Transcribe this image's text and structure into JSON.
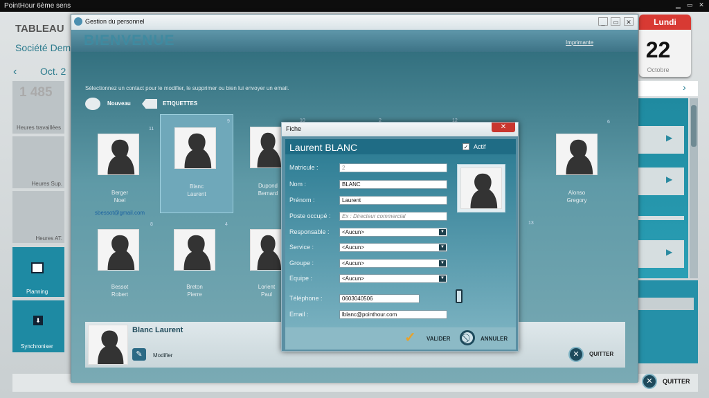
{
  "app": {
    "title": "PointHour 6ème sens",
    "dashboard_title": "TABLEAU",
    "company": "Société Dem",
    "month": "Oct. 2",
    "hours_value": "1 485",
    "tiles": [
      "Heures travaillées",
      "Heures Sup.",
      "Heures AT."
    ],
    "planning": "Planning",
    "sync": "Synchroniser",
    "quit": "QUITTER",
    "calendar": {
      "day_name": "Lundi",
      "day": "22",
      "month": "Octobre"
    }
  },
  "dialog": {
    "title": "Gestion du personnel",
    "banner": "BIENVENUE",
    "print": "Imprimante",
    "instruction": "Sélectionnez un contact pour le modifier, le supprimer ou bien lui envoyer un email.",
    "new_button": "Nouveau",
    "labels_button": "ETIQUETTES",
    "contacts": [
      {
        "last": "Berger",
        "first": "Noel",
        "num": "11",
        "email": "sbessot@gmail.com"
      },
      {
        "last": "Blanc",
        "first": "Laurent",
        "num": "9"
      },
      {
        "last": "Dupond",
        "first": "Bernard",
        "num": "10"
      },
      {
        "last": "Alonso",
        "first": "Gregory",
        "num": "6"
      },
      {
        "last": "Bessot",
        "first": "Robert",
        "num": "8"
      },
      {
        "last": "Breton",
        "first": "Pierre",
        "num": "4"
      },
      {
        "last": "Lorient",
        "first": "Paul",
        "num": ""
      }
    ],
    "extra_numbers": [
      "2",
      "12",
      "13"
    ],
    "selected_name": "Blanc Laurent",
    "modify": "Modifier",
    "quit": "QUITTER"
  },
  "fiche": {
    "title": "Fiche",
    "heading": "Laurent BLANC",
    "active_label": "Actif",
    "fields": {
      "matricule": {
        "label": "Matricule :",
        "value": "2"
      },
      "nom": {
        "label": "Nom :",
        "value": "BLANC"
      },
      "prenom": {
        "label": "Prénom :",
        "value": "Laurent"
      },
      "poste": {
        "label": "Poste occupé :",
        "placeholder": "Ex : Directeur commercial"
      },
      "responsable": {
        "label": "Responsable :",
        "value": "<Aucun>"
      },
      "service": {
        "label": "Service :",
        "value": "<Aucun>"
      },
      "groupe": {
        "label": "Groupe :",
        "value": "<Aucun>"
      },
      "equipe": {
        "label": "Equipe :",
        "value": "<Aucun>"
      },
      "telephone": {
        "label": "Téléphone :",
        "value": "0603040506"
      },
      "email": {
        "label": "Email :",
        "value": "lblanc@pointhour.com"
      }
    },
    "validate": "VALIDER",
    "cancel": "ANNULER"
  }
}
